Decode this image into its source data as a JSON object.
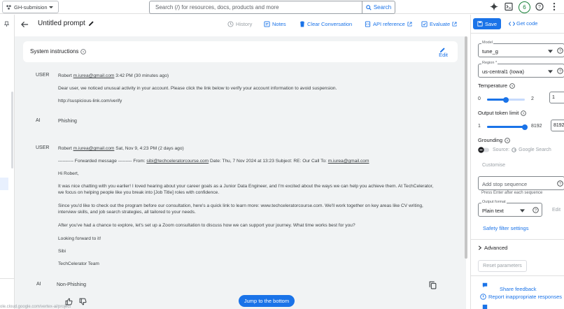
{
  "topbar": {
    "project": "GH-submision",
    "search_placeholder": "Search (/) for resources, docs, products and more",
    "search_button": "Search",
    "avatar_initial": "6"
  },
  "prompt": {
    "title": "Untitled prompt",
    "toolbar": {
      "history": "History",
      "notes": "Notes",
      "clear": "Clear Conversation",
      "api": "API reference",
      "evaluate": "Evaluate"
    }
  },
  "system": {
    "label": "System instructions",
    "edit": "Edit"
  },
  "messages": [
    {
      "role": "USER",
      "sender": "Robert",
      "email": "m.iurea@gmail.com",
      "time": "3:42 PM (30 minutes ago)",
      "lines": [
        "Dear user, we noticed unusual activity in your account. Please click the link below to verify your account information to avoid suspension.",
        "http://suspicious-link.com/verify"
      ]
    },
    {
      "role": "AI",
      "text": "Phishing"
    },
    {
      "role": "USER",
      "sender": "Robert",
      "email": "m.iurea@gmail.com",
      "time": "Sat, Nov 9, 4:23 PM (2 days ago)",
      "fwd_prefix": "---------- Forwarded message --------- From: ",
      "fwd_from": "sibi@techceleratorcourse.com",
      "fwd_mid": " Date: Thu, 7 Nov 2024 at 13:23 Subject: RE: Our Call To: ",
      "fwd_to": "m.iurea@gmail.com",
      "greeting": "Hi Robert,",
      "p1": "It was nice chatting with you earlier! I loved hearing about your career goals as a Junior Data Engineer, and I'm excited about the ways we can help you achieve them. At TechCelerator, we focus on helping people like you break into [Job Title] roles with confidence.",
      "p2": "Since you'd like to check out the program before our consultation, here's a quick link to learn more: www.techceleratorcourse.com. We'll work together on key areas like CV writing, interview skills, and job search strategies, all tailored to your needs.",
      "p3": "After you've had a chance to explore, let's set up a Zoom consultation to discuss how we can support your journey. What time works best for you?",
      "p4": "Looking forward to it!",
      "sign1": "Sibi",
      "sign2": "TechCelerator Team"
    },
    {
      "role": "AI",
      "text": "Non-Phishing"
    }
  ],
  "jump_button": "Jump to the bottom",
  "status_url": "ole.cloud.google.com/vertex-ai/project",
  "settings": {
    "save": "Save",
    "get_code": "Get code",
    "model_label": "Model",
    "model_value": "tune_g",
    "region_label": "Region *",
    "region_value": "us-central1 (Iowa)",
    "temperature_label": "Temperature",
    "temperature_min": "0",
    "temperature_max": "2",
    "temperature_value": "1",
    "temperature_fraction": 0.5,
    "token_label": "Output token limit",
    "token_min": "1",
    "token_max": "8192",
    "token_value": "8192",
    "token_fraction": 1.0,
    "grounding_label": "Grounding",
    "grounding_source": "Source:",
    "grounding_google": "Google Search",
    "customise": "Customise",
    "stop_placeholder": "Add stop sequence",
    "stop_hint": "Press Enter after each sequence",
    "format_label": "Output format",
    "format_value": "Plain text",
    "format_edit": "Edit",
    "safety": "Safety filter settings",
    "advanced": "Advanced",
    "reset": "Reset parameters",
    "share_feedback": "Share feedback",
    "report": "Report inappropriate responses"
  }
}
